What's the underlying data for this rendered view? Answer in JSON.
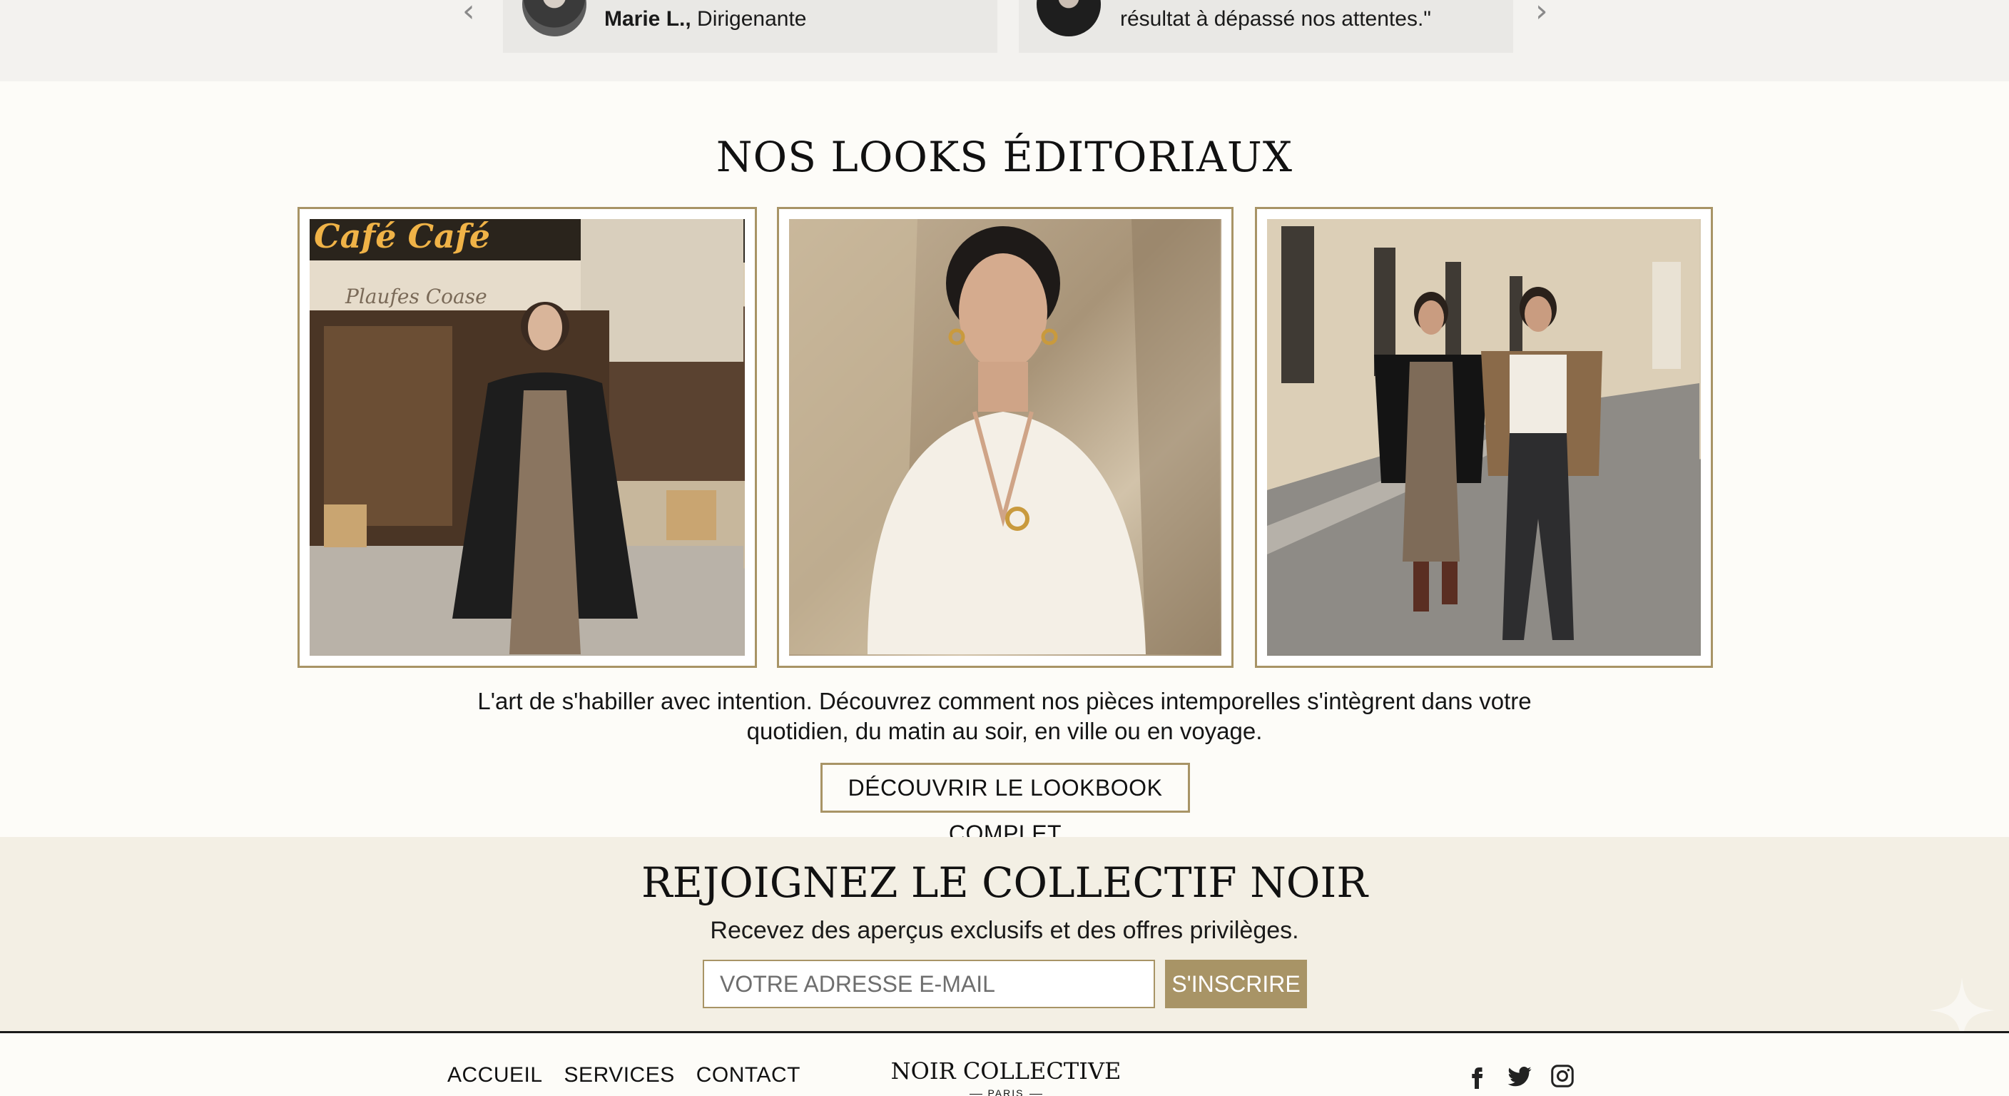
{
  "testimonials": {
    "card1": {
      "name": "Marie L.,",
      "role": "Dirigenante"
    },
    "card2": {
      "quote": "résultat à dépassé nos attentes.\""
    }
  },
  "editorial": {
    "title": "NOS LOOKS ÉDITORIAUX",
    "images": [
      {
        "sign": "Café Café",
        "awning": "Plaufes Coase"
      },
      {},
      {}
    ],
    "description": "L'art de s'habiller avec intention. Découvrez comment nos pièces intemporelles s'intègrent dans votre quotidien, du matin au soir, en ville ou en voyage.",
    "cta": "DÉCOUVRIR LE LOOKBOOK COMPLET"
  },
  "newsletter": {
    "title": "REJOIGNEZ LE COLLECTIF NOIR",
    "subtitle": "Recevez des aperçus exclusifs et des offres privilèges.",
    "email_placeholder": "VOTRE ADRESSE E-MAIL",
    "submit_label": "S'INSCRIRE"
  },
  "footer": {
    "nav": [
      "ACCUEIL",
      "SERVICES",
      "CONTACT"
    ],
    "brand": "NOIR COLLECTIVE",
    "brand_sub": "PARIS",
    "social_icons": [
      "facebook-icon",
      "twitter-icon",
      "instagram-icon"
    ]
  },
  "colors": {
    "accent": "#a89466",
    "section_bg": "#f3efe4",
    "testimonials_bg": "#f3f2ef"
  }
}
